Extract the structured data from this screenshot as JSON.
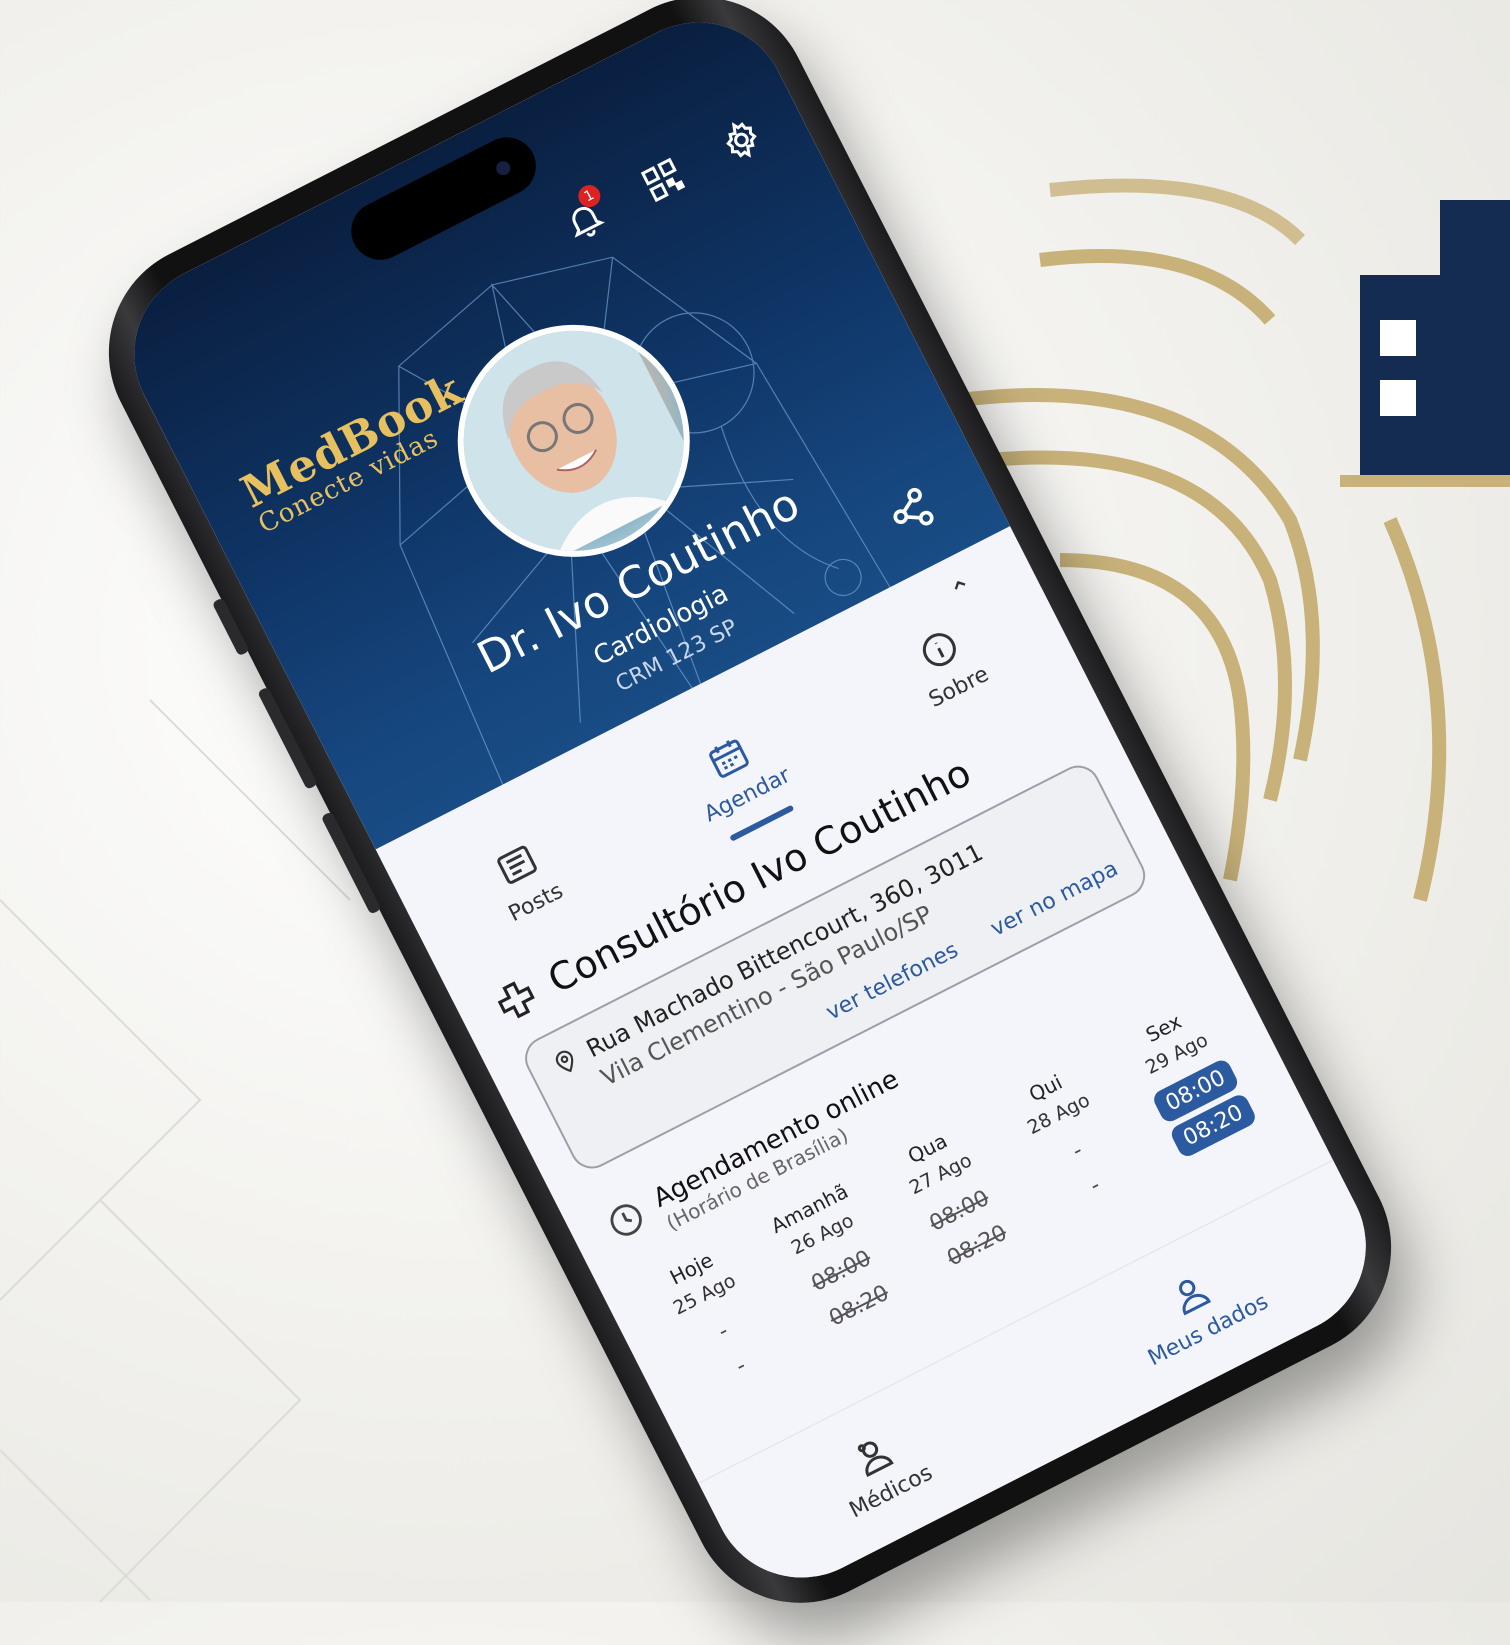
{
  "app": {
    "brand_name": "MedBook",
    "brand_tagline": "Conecte vidas",
    "notification_count": "1",
    "accent_color": "#2c5aa0",
    "header_color": "#0f3566",
    "brand_color": "#e7c160"
  },
  "profile": {
    "name": "Dr. Ivo Coutinho",
    "specialty": "Cardiologia",
    "crm": "CRM 123 SP"
  },
  "tabs": [
    {
      "label": "Posts",
      "icon": "newspaper-icon"
    },
    {
      "label": "Agendar",
      "icon": "calendar-icon",
      "active": true
    },
    {
      "label": "Sobre",
      "icon": "info-icon"
    }
  ],
  "clinic": {
    "title": "Consultório Ivo Coutinho",
    "address_line1": "Rua Machado Bittencourt, 360, 3011",
    "address_line2": "Vila Clementino - São Paulo/SP",
    "link_phones": "ver telefones",
    "link_map": "ver no mapa"
  },
  "schedule": {
    "title": "Agendamento online",
    "subtitle": "(Horário de Brasília)",
    "days": [
      {
        "label": "Hoje",
        "date": "25 Ago",
        "slots": [
          {
            "t": "-",
            "s": "none"
          },
          {
            "t": "-",
            "s": "none"
          }
        ]
      },
      {
        "label": "Amanhã",
        "date": "26 Ago",
        "slots": [
          {
            "t": "08:00",
            "s": "taken"
          },
          {
            "t": "08:20",
            "s": "taken"
          }
        ]
      },
      {
        "label": "Qua",
        "date": "27 Ago",
        "slots": [
          {
            "t": "08:00",
            "s": "taken"
          },
          {
            "t": "08:20",
            "s": "taken"
          }
        ]
      },
      {
        "label": "Qui",
        "date": "28 Ago",
        "slots": [
          {
            "t": "-",
            "s": "none"
          },
          {
            "t": "-",
            "s": "none"
          }
        ]
      },
      {
        "label": "Sex",
        "date": "29 Ago",
        "slots": [
          {
            "t": "08:00",
            "s": "free"
          },
          {
            "t": "08:20",
            "s": "free"
          }
        ]
      }
    ]
  },
  "bottom_nav": [
    {
      "label": "Médicos",
      "icon": "doctors-icon"
    },
    {
      "label": "Meus dados",
      "icon": "user-icon",
      "active": true
    }
  ]
}
